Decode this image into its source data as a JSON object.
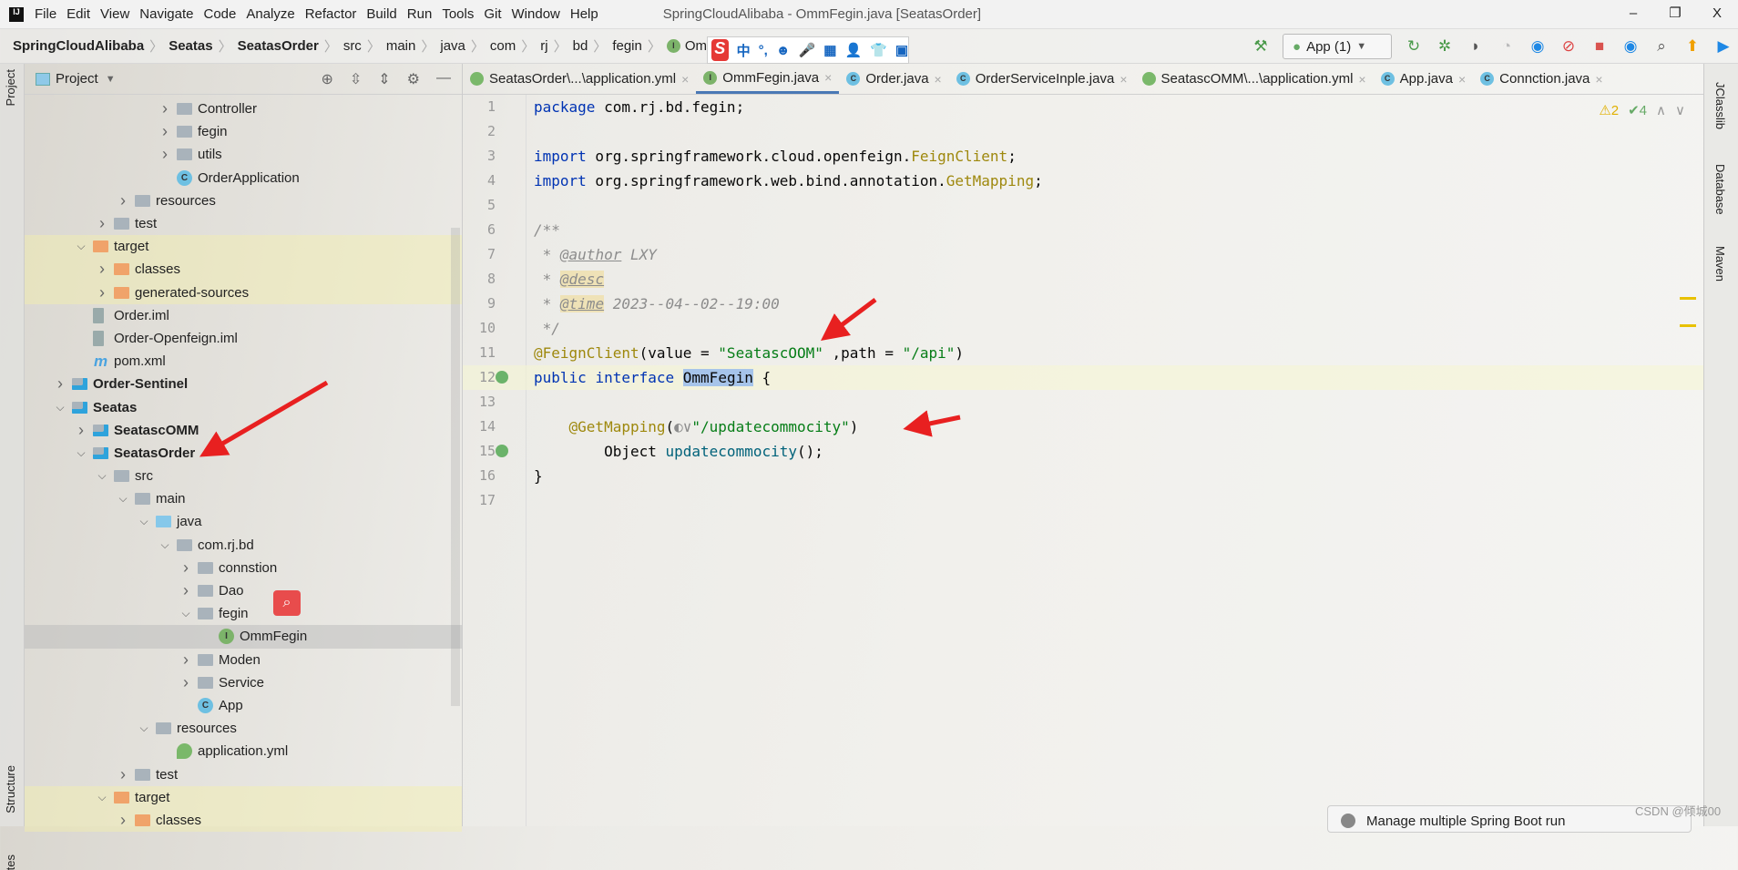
{
  "window": {
    "title": "SpringCloudAlibaba - OmmFegin.java [SeatasOrder]",
    "logo": "IJ",
    "controls": [
      "–",
      "❐",
      "X"
    ]
  },
  "menu": [
    "File",
    "Edit",
    "View",
    "Navigate",
    "Code",
    "Analyze",
    "Refactor",
    "Build",
    "Run",
    "Tools",
    "Git",
    "Window",
    "Help"
  ],
  "breadcrumb": [
    {
      "label": "SpringCloudAlibaba",
      "bold": true
    },
    {
      "label": "Seatas",
      "bold": true
    },
    {
      "label": "SeatasOrder",
      "bold": true
    },
    {
      "label": "src"
    },
    {
      "label": "main"
    },
    {
      "label": "java"
    },
    {
      "label": "com"
    },
    {
      "label": "rj"
    },
    {
      "label": "bd"
    },
    {
      "label": "fegin"
    },
    {
      "label": "OmmFegin",
      "icon": "interface-icon"
    }
  ],
  "ime_toolbar": {
    "logo": "S",
    "items": [
      "中",
      "°,",
      "☻",
      "🎤",
      "▦",
      "👤",
      "👕",
      "▣"
    ]
  },
  "toolbar": {
    "run_config": "App (1)",
    "icons": [
      "build-hammer-icon",
      "rerun-icon",
      "debug-icon",
      "coverage-icon",
      "profiler-icon",
      "more-dropdown-icon",
      "jrebel-icon",
      "debug-stop-icon",
      "stop-icon",
      "jrebel-run-icon",
      "search-icon",
      "update-icon",
      "toolbox-icon"
    ]
  },
  "left_strip": {
    "project": "Project",
    "structure": "Structure",
    "favorites": "tes"
  },
  "project_panel": {
    "title": "Project"
  },
  "tree": [
    {
      "label": "Controller",
      "level": 5,
      "chev": "right",
      "icon": "pkg"
    },
    {
      "label": "fegin",
      "level": 5,
      "chev": "right",
      "icon": "pkg"
    },
    {
      "label": "utils",
      "level": 5,
      "chev": "right",
      "icon": "pkg"
    },
    {
      "label": "OrderApplication",
      "level": 5,
      "icon": "spring-class"
    },
    {
      "label": "resources",
      "level": 3,
      "chev": "right",
      "icon": "res"
    },
    {
      "label": "test",
      "level": 2,
      "chev": "right",
      "icon": "folder"
    },
    {
      "label": "target",
      "level": 1,
      "chev": "down",
      "icon": "excluded",
      "hl": true
    },
    {
      "label": "classes",
      "level": 2,
      "chev": "right",
      "icon": "excluded",
      "hl": true
    },
    {
      "label": "generated-sources",
      "level": 2,
      "chev": "right",
      "icon": "excluded",
      "hl": true
    },
    {
      "label": "Order.iml",
      "level": 1,
      "icon": "file"
    },
    {
      "label": "Order-Openfeign.iml",
      "level": 1,
      "icon": "file"
    },
    {
      "label": "pom.xml",
      "level": 1,
      "icon": "maven"
    },
    {
      "label": "Order-Sentinel",
      "level": 0,
      "chev": "right",
      "icon": "module",
      "bold": true
    },
    {
      "label": "Seatas",
      "level": 0,
      "chev": "down",
      "icon": "module",
      "bold": true
    },
    {
      "label": "SeatascOMM",
      "level": 1,
      "chev": "right",
      "icon": "module",
      "bold": true
    },
    {
      "label": "SeatasOrder",
      "level": 1,
      "chev": "down",
      "icon": "module",
      "bold": true
    },
    {
      "label": "src",
      "level": 2,
      "chev": "down",
      "icon": "folder"
    },
    {
      "label": "main",
      "level": 3,
      "chev": "down",
      "icon": "folder"
    },
    {
      "label": "java",
      "level": 4,
      "chev": "down",
      "icon": "source"
    },
    {
      "label": "com.rj.bd",
      "level": 5,
      "chev": "down",
      "icon": "pkg"
    },
    {
      "label": "connstion",
      "level": 6,
      "chev": "right",
      "icon": "pkg"
    },
    {
      "label": "Dao",
      "level": 6,
      "chev": "right",
      "icon": "pkg"
    },
    {
      "label": "fegin",
      "level": 6,
      "chev": "down",
      "icon": "pkg"
    },
    {
      "label": "OmmFegin",
      "level": 7,
      "icon": "interface",
      "sel": true
    },
    {
      "label": "Moden",
      "level": 6,
      "chev": "right",
      "icon": "pkg"
    },
    {
      "label": "Service",
      "level": 6,
      "chev": "right",
      "icon": "pkg"
    },
    {
      "label": "App",
      "level": 6,
      "icon": "spring-class"
    },
    {
      "label": "resources",
      "level": 4,
      "chev": "down",
      "icon": "res"
    },
    {
      "label": "application.yml",
      "level": 5,
      "icon": "yml"
    },
    {
      "label": "test",
      "level": 3,
      "chev": "right",
      "icon": "folder"
    },
    {
      "label": "target",
      "level": 2,
      "chev": "down",
      "icon": "excluded",
      "hl": true
    },
    {
      "label": "classes",
      "level": 3,
      "chev": "right",
      "icon": "excluded",
      "hl": true
    }
  ],
  "tabs": [
    {
      "label": "SeatasOrder\\...\\application.yml",
      "icon": "yml"
    },
    {
      "label": "OmmFegin.java",
      "icon": "interface",
      "active": true
    },
    {
      "label": "Order.java",
      "icon": "class"
    },
    {
      "label": "OrderServiceInple.java",
      "icon": "class"
    },
    {
      "label": "SeatascOMM\\...\\application.yml",
      "icon": "yml"
    },
    {
      "label": "App.java",
      "icon": "spring-class"
    },
    {
      "label": "Connction.java",
      "icon": "class"
    }
  ],
  "inspections": {
    "warnings": "⚠2",
    "weak": "✔4",
    "up": "∧",
    "down": "∨"
  },
  "code": [
    [
      [
        "package",
        "kw"
      ],
      [
        " com.rj.bd.fegin;",
        "plain"
      ]
    ],
    [],
    [
      [
        "import",
        "kw"
      ],
      [
        " org.springframework.cloud.openfeign.",
        "plain"
      ],
      [
        "FeignClient",
        "ann"
      ],
      [
        ";",
        "plain"
      ]
    ],
    [
      [
        "import",
        "kw"
      ],
      [
        " org.springframework.web.bind.annotation.",
        "plain"
      ],
      [
        "GetMapping",
        "ann"
      ],
      [
        ";",
        "plain"
      ]
    ],
    [],
    [
      [
        "/**",
        "cm"
      ]
    ],
    [
      [
        " * ",
        "cm"
      ],
      [
        "@author",
        "tag"
      ],
      [
        " LXY",
        "cm"
      ]
    ],
    [
      [
        " * ",
        "cm"
      ],
      [
        "@desc",
        "tag bgy"
      ]
    ],
    [
      [
        " * ",
        "cm"
      ],
      [
        "@time",
        "tag bgy"
      ],
      [
        " 2023--04--02--19:00",
        "cm"
      ]
    ],
    [
      [
        " */",
        "cm"
      ]
    ],
    [
      [
        "@FeignClient",
        "ann"
      ],
      [
        "(value = ",
        "plain"
      ],
      [
        "\"SeatascOOM\"",
        "str"
      ],
      [
        " ,path = ",
        "plain"
      ],
      [
        "\"/api\"",
        "str"
      ],
      [
        ")",
        "plain"
      ]
    ],
    [
      [
        "public",
        "kw"
      ],
      [
        " ",
        "plain"
      ],
      [
        "interface",
        "kw"
      ],
      [
        " ",
        "plain"
      ],
      [
        "OmmFegin",
        "plain selw"
      ],
      [
        " {",
        "plain"
      ]
    ],
    [],
    [
      [
        "    ",
        "plain"
      ],
      [
        "@GetMapping",
        "ann"
      ],
      [
        "(",
        "plain"
      ],
      [
        "◐∨",
        "cm"
      ],
      [
        "\"/updatecommocity\"",
        "str"
      ],
      [
        ")",
        "plain"
      ]
    ],
    [
      [
        "        Object ",
        "plain"
      ],
      [
        "updatecommocity",
        "id"
      ],
      [
        "();",
        "plain"
      ]
    ],
    [
      [
        "}",
        "plain"
      ]
    ],
    []
  ],
  "gutter_marks": {
    "12": "implemented-icon",
    "15": "implemented-icon"
  },
  "current_line": 12,
  "right_strip": [
    "JClasslib",
    "Database",
    "Maven"
  ],
  "notification": "Manage multiple Spring Boot run",
  "watermark": "CSDN @倾城00",
  "colors": {
    "accent": "#4a78b5",
    "keyword": "#0033b3",
    "annotation": "#9e880d",
    "string": "#067d17",
    "arrow": "#e82020"
  }
}
